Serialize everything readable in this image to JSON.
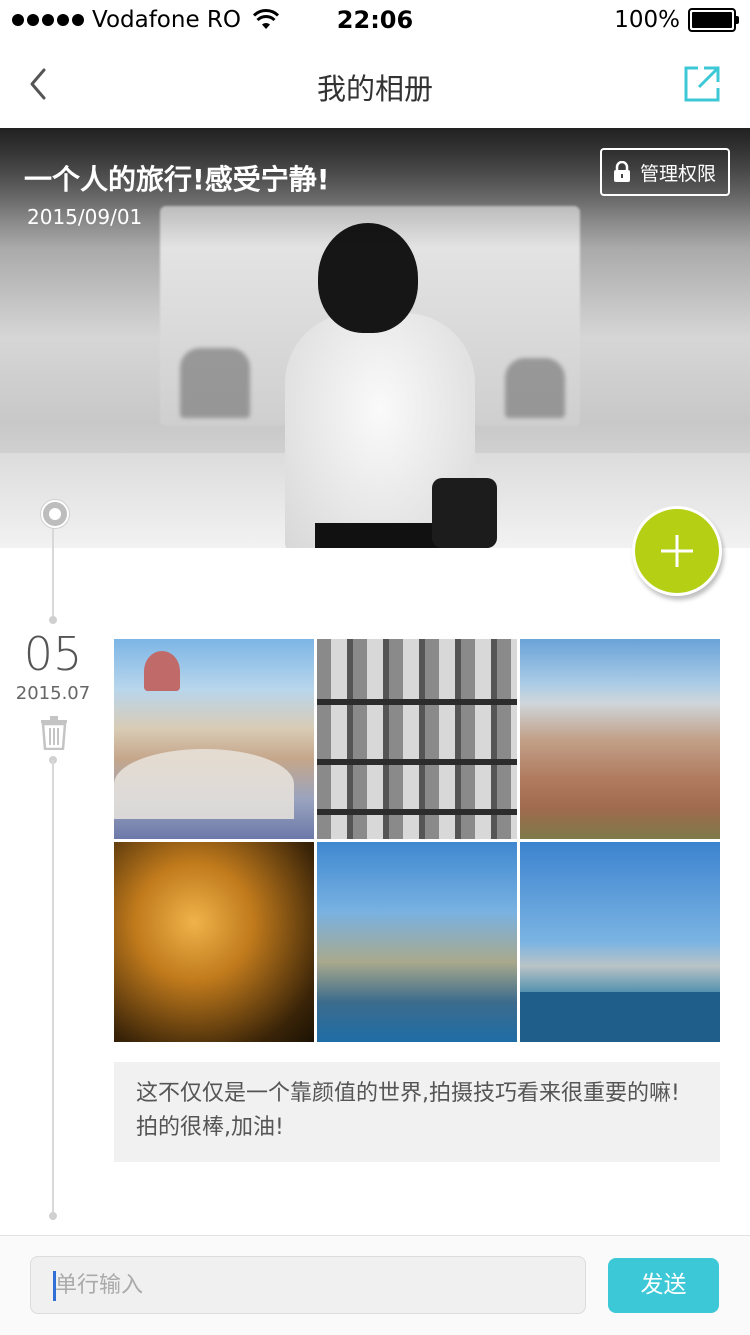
{
  "status_bar": {
    "carrier": "Vodafone RO",
    "time": "22:06",
    "battery": "100%"
  },
  "nav": {
    "title": "我的相册"
  },
  "album": {
    "title": "一个人的旅行!感受宁静!",
    "date": "2015/09/01",
    "manage_label": "管理权限"
  },
  "entry": {
    "day": "05",
    "year_month": "2015.07",
    "photo_count": 6,
    "comment": "这不仅仅是一个靠颜值的世界,拍摄技巧看来很重要的嘛!拍的很棒,加油!"
  },
  "composer": {
    "placeholder": "单行输入",
    "send_label": "发送"
  },
  "colors": {
    "accent": "#3cc8d6",
    "add_button": "#b5cf14"
  },
  "icons": [
    "back-icon",
    "share-icon",
    "lock-icon",
    "plus-icon",
    "trash-icon"
  ]
}
